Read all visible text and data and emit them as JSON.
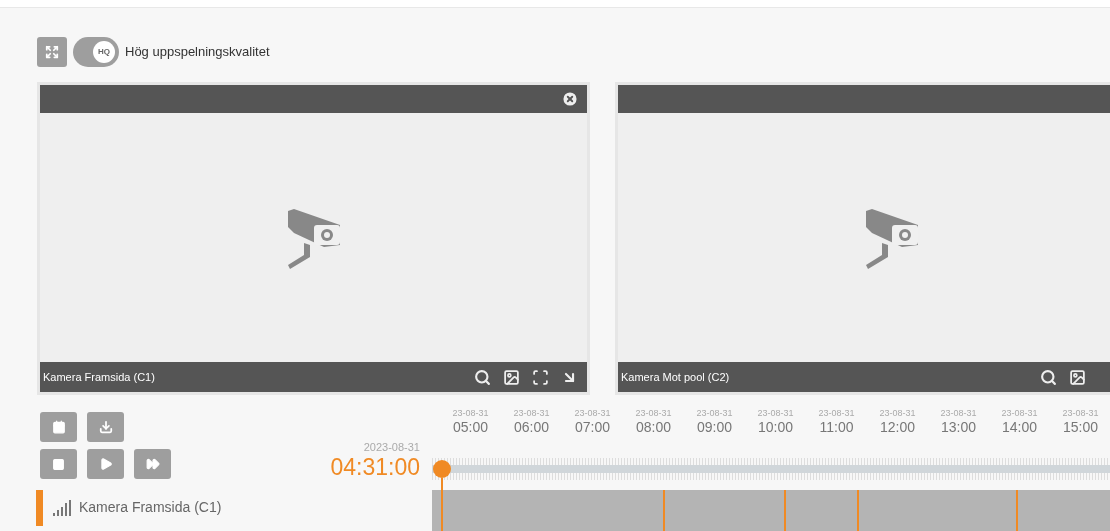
{
  "toolbar": {
    "quality_toggle": {
      "badge": "HQ",
      "on": true
    },
    "quality_label": "Hög uppspelningskvalitet"
  },
  "cameras": [
    {
      "name": "Kamera Framsida (C1)",
      "closable": true
    },
    {
      "name": "Kamera Mot pool (C2)"
    }
  ],
  "playback": {
    "date": "2023-08-31",
    "time": "04:31:00"
  },
  "timeline": {
    "ticks": [
      {
        "date": "23-08-31",
        "time": "05:00"
      },
      {
        "date": "23-08-31",
        "time": "06:00"
      },
      {
        "date": "23-08-31",
        "time": "07:00"
      },
      {
        "date": "23-08-31",
        "time": "08:00"
      },
      {
        "date": "23-08-31",
        "time": "09:00"
      },
      {
        "date": "23-08-31",
        "time": "10:00"
      },
      {
        "date": "23-08-31",
        "time": "11:00"
      },
      {
        "date": "23-08-31",
        "time": "12:00"
      },
      {
        "date": "23-08-31",
        "time": "13:00"
      },
      {
        "date": "23-08-31",
        "time": "14:00"
      },
      {
        "date": "23-08-31",
        "time": "15:00"
      }
    ]
  },
  "camera_list": [
    {
      "name": "Kamera Framsida (C1)",
      "selected": true
    }
  ]
}
